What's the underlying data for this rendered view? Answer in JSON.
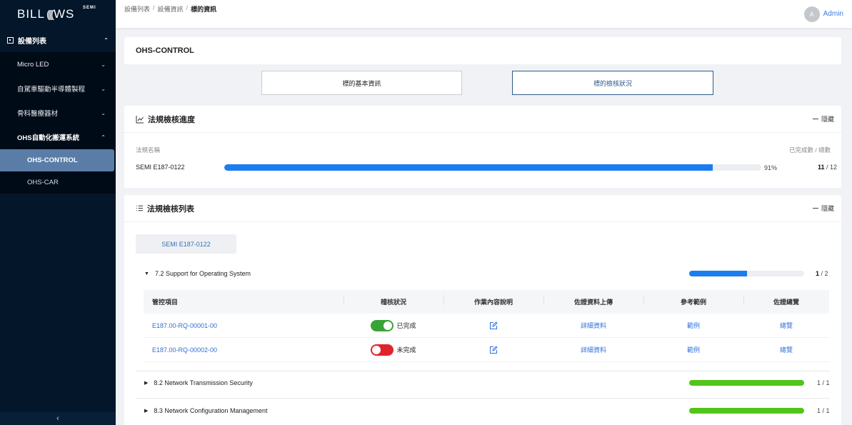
{
  "sidebar": {
    "logo": {
      "text_left": "BILL",
      "text_right": "WS",
      "superscript": "SEMI"
    },
    "group": {
      "label": "設備列表"
    },
    "items": [
      {
        "label": "Micro LED"
      },
      {
        "label": "自駕車驅動半導體製程"
      },
      {
        "label": "骨科醫療器材"
      },
      {
        "label": "OHS自動化搬運系統"
      }
    ],
    "subitems": [
      {
        "label": "OHS-CONTROL",
        "active": true
      },
      {
        "label": "OHS-CAR",
        "active": false
      }
    ],
    "collapse_glyph": "‹"
  },
  "breadcrumb": {
    "items": [
      "設備列表",
      "設備資訊",
      "標的資訊"
    ],
    "separator": "/"
  },
  "user": {
    "avatar_letter": "A",
    "name": "Admin"
  },
  "device": {
    "title": "OHS-CONTROL"
  },
  "tabs": [
    {
      "label": "標的基本資訊",
      "active": false
    },
    {
      "label": "標的檢核狀況",
      "active": true
    }
  ],
  "progress_card": {
    "title": "法規檢核進度",
    "hide_label": "隱藏",
    "col_name": "法規名稱",
    "col_count": "已完成數 / 總數",
    "row": {
      "name": "SEMI E187-0122",
      "percent_label": "91%",
      "percent": 0.91,
      "done": "11",
      "total": "12"
    }
  },
  "list_card": {
    "title": "法規檢核列表",
    "hide_label": "隱藏",
    "standard_tab": "SEMI E187-0122",
    "sections": [
      {
        "label": "7.2 Support for Operating System",
        "expanded": true,
        "done": "1",
        "total": "2",
        "progress": 0.5,
        "color": "#1a7df0"
      },
      {
        "label": "8.2 Network Transmission Security",
        "expanded": false,
        "done": "1",
        "total": "1",
        "progress": 1.0,
        "color": "#52c41a"
      },
      {
        "label": "8.3 Network Configuration Management",
        "expanded": false,
        "done": "1",
        "total": "1",
        "progress": 1.0,
        "color": "#52c41a"
      }
    ],
    "table": {
      "headers": [
        "管控項目",
        "稽核狀況",
        "作業內容說明",
        "佐證資料上傳",
        "參考範例",
        "佐證總覽"
      ],
      "rows": [
        {
          "id": "E187.00-RQ-00001-00",
          "status": "已完成",
          "on": true,
          "detail": "詳細資料",
          "example": "範例",
          "overview": "總覽"
        },
        {
          "id": "E187.00-RQ-00002-00",
          "status": "未完成",
          "on": false,
          "detail": "詳細資料",
          "example": "範例",
          "overview": "總覽"
        }
      ]
    }
  },
  "colors": {
    "sidebar_bg": "#041629",
    "active_item": "#5a7da8",
    "primary_blue": "#1a7df0",
    "success_green": "#52c41a",
    "toggle_on": "#3aa336",
    "toggle_off": "#e0242b",
    "link": "#2f6fd6"
  }
}
